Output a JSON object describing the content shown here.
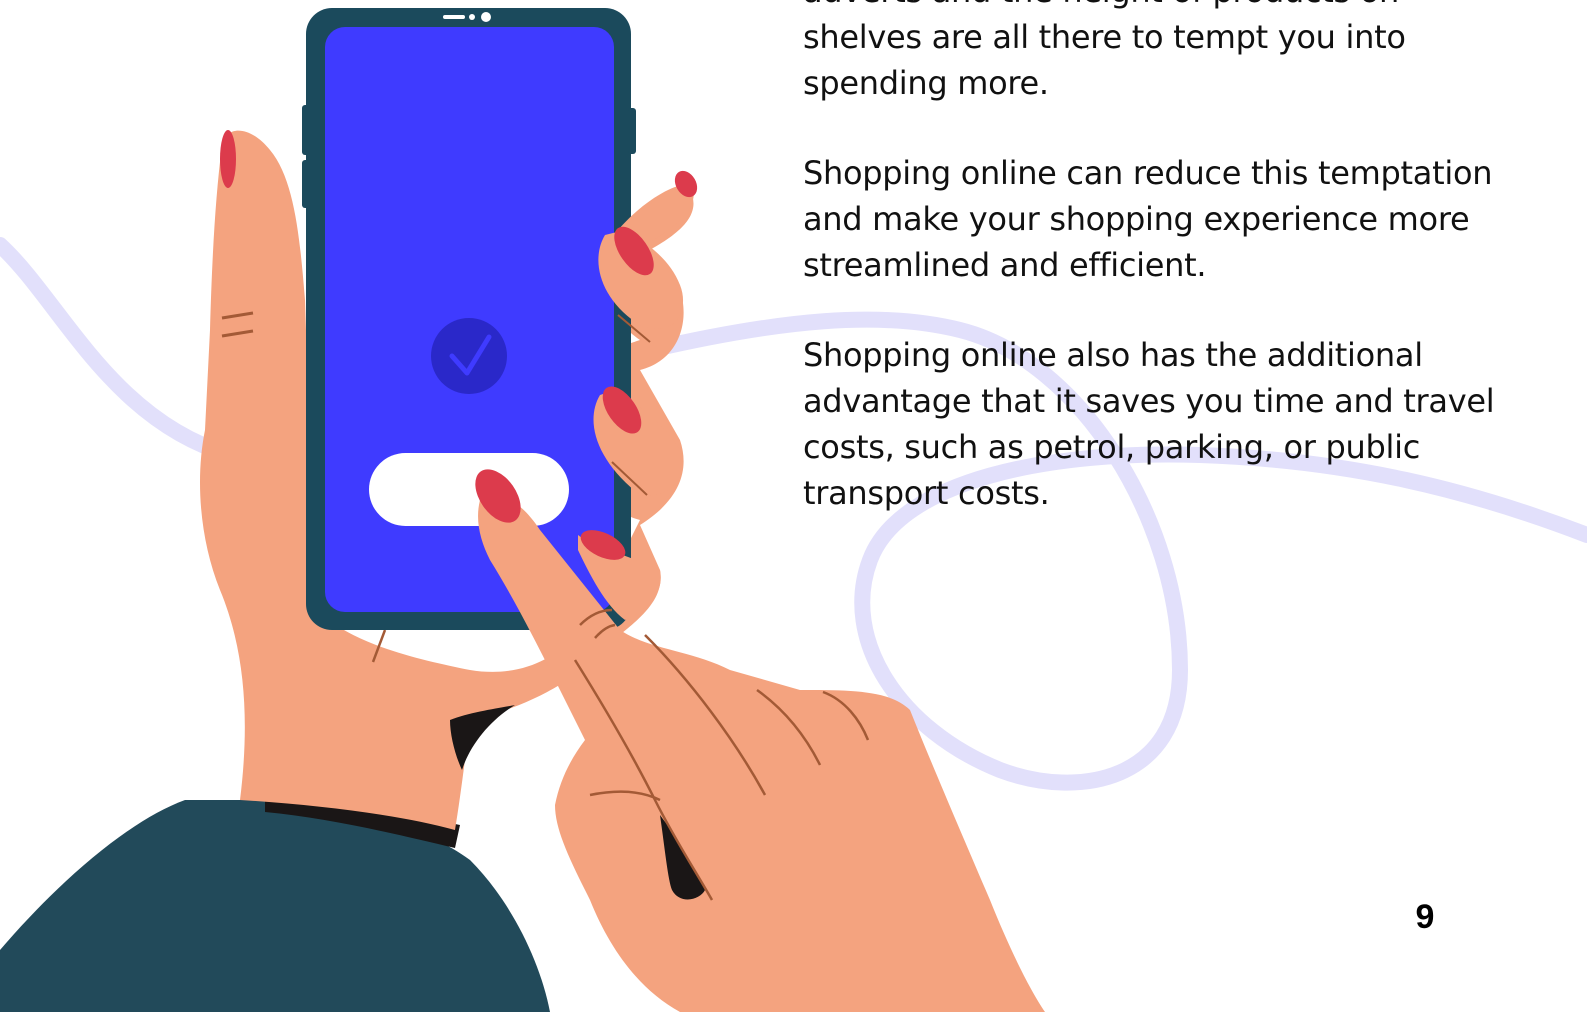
{
  "body": {
    "paragraphs": [
      "adverts and the height of products on shelves are all there to tempt you into spending more.",
      "Shopping online can reduce this temptation and make your shopping experience more streamlined and efficient.",
      "Shopping online also has the additional advantage that it saves you time and travel costs, such as petrol, parking, or public transport costs."
    ]
  },
  "page_number": "9",
  "illustration": {
    "subject": "hands-holding-smartphone",
    "phone_screen_color": "#3f3bff",
    "phone_body_color": "#1b4a5c",
    "skin_color": "#f4a37f",
    "nail_color": "#dc3b4c",
    "sleeve_color": "#224a5a",
    "swirl_color": "#e2e0fb",
    "icon": "check-icon"
  }
}
